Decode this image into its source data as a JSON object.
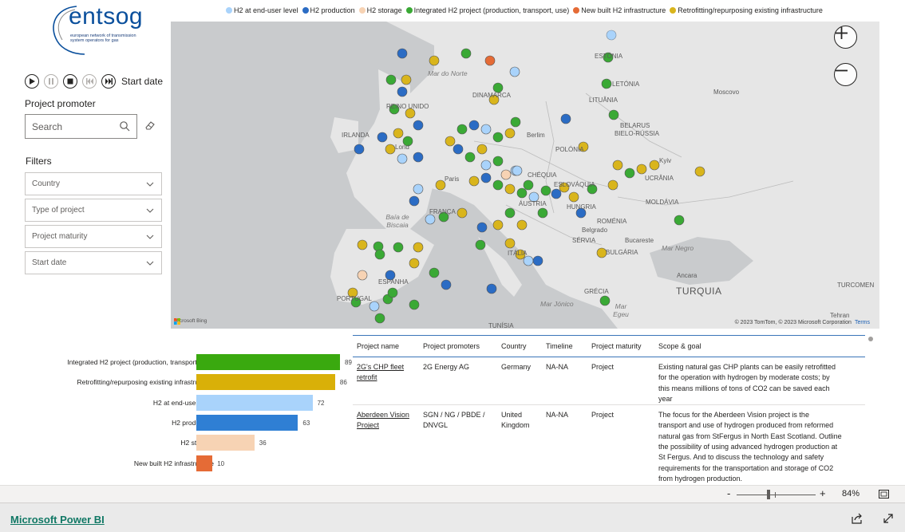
{
  "logo": {
    "wordmark": "entsog",
    "subtitle": "european network of transmission system operators for gas"
  },
  "playback": {
    "label": "Start date",
    "buttons": [
      "play-icon",
      "pause-icon",
      "stop-icon",
      "previous-icon",
      "next-icon"
    ]
  },
  "promoter": {
    "title": "Project promoter",
    "search_placeholder": "Search"
  },
  "filters": {
    "title": "Filters",
    "items": [
      {
        "label": "Country"
      },
      {
        "label": "Type of project"
      },
      {
        "label": "Project maturity"
      },
      {
        "label": "Start date"
      }
    ]
  },
  "legend": [
    {
      "label": "H2 at end-user level",
      "color": "#a9d3fb"
    },
    {
      "label": "H2 production",
      "color": "#2b6cc4"
    },
    {
      "label": "H2 storage",
      "color": "#f7d3b4"
    },
    {
      "label": "Integrated H2 project (production, transport, use)",
      "color": "#3aa935"
    },
    {
      "label": "New built H2 infrastructure",
      "color": "#e56b36"
    },
    {
      "label": "Retrofitting/repurposing existing infrastructure",
      "color": "#d9b51c"
    }
  ],
  "map": {
    "labels": {
      "mar_do_norte": "Mar do Norte",
      "reino_unido": "REINO UNIDO",
      "irlanda": "IRLANDA",
      "london": "Lond",
      "paris": "Paris",
      "franca": "FRANÇA",
      "baia": "Baía de Biscaia",
      "espanha": "ESPANHA",
      "portugal": "PORTUGAL",
      "italia": "ITÁLIA",
      "berlim": "Berlim",
      "polonia": "POLÓNIA",
      "chequia": "CHÉQUIA",
      "austria": "ÁUSTRIA",
      "eslovaquia": "ESLOVÁQUIA",
      "hungria": "HUNGRIA",
      "romenia": "ROMÉNIA",
      "moldavia": "MOLDÁVIA",
      "ucrania": "UCRÂNIA",
      "kyiv": "Kyiv",
      "belarus": "BELARUS",
      "bielo": "BIELO-RÚSSIA",
      "lituania": "LITUÂNIA",
      "letonia": "LETÓNIA",
      "estonia": "ESTÓNIA",
      "moscovo": "Moscovo",
      "dinamarca": "DINAMARCA",
      "belgrado": "Belgrado",
      "servia": "SÉRVIA",
      "bucareste": "Bucareste",
      "bulgaria": "BULGÁRIA",
      "mar_negro": "Mar Negro",
      "ancara": "Ancara",
      "turquia": "TURQUIA",
      "grecia": "GRÉCIA",
      "mar_jonico": "Mar Jónico",
      "mar_egeu": "Mar Egeu",
      "turcomen": "TURCOMEN",
      "tunisia": "TUNÍSIA",
      "tehran": "Tehran"
    },
    "bing": "Microsoft Bing",
    "copyright": "© 2023 TomTom, © 2023 Microsoft Corporation",
    "terms": "Terms"
  },
  "chart_data": {
    "type": "bar",
    "orientation": "horizontal",
    "categories": [
      "Integrated H2 project (production, transport, use)",
      "Retrofitting/repurposing existing infrastructure",
      "H2 at end-user level",
      "H2 production",
      "H2 storage",
      "New built H2 infrastructure"
    ],
    "values": [
      89,
      86,
      72,
      63,
      36,
      10
    ],
    "colors": [
      "#3aa90f",
      "#d9b008",
      "#a9d3fb",
      "#2f7fd4",
      "#f7d3b4",
      "#e56b36"
    ],
    "xlim": [
      0,
      89
    ]
  },
  "table": {
    "headers": [
      "Project name",
      "Project promoters",
      "Country",
      "Timeline",
      "Project maturity",
      "Scope & goal"
    ],
    "rows": [
      {
        "name": [
          "2G's CHP fleet",
          "retrofit"
        ],
        "promoters": [
          "2G Energy AG"
        ],
        "country": [
          "Germany"
        ],
        "timeline": "NA-NA",
        "maturity": "Project",
        "scope": [
          "Existing natural gas CHP plants can be easily retrofitted",
          "for the operation with hydrogen by moderate costs; by",
          "this means millions of tons of CO2 can be saved each",
          "year"
        ]
      },
      {
        "name": [
          "Aberdeen Vision",
          "Project"
        ],
        "promoters": [
          "SGN / NG / PBDE /",
          "DNVGL"
        ],
        "country": [
          "United",
          "Kingdom"
        ],
        "timeline": "NA-NA",
        "maturity": "Project",
        "scope": [
          "The focus for the Aberdeen Vision project is the",
          "transport and use of hydrogen produced from reformed",
          "natural gas from StFergus in North East Scotland. Outline",
          "the possibility of using advanced hydrogen production at",
          "St Fergus. And to discuss the technology and safety",
          "requirements for the transportation and storage of CO2",
          "from hydrogen production."
        ]
      }
    ]
  },
  "zoom": {
    "minus": "-",
    "plus": "+",
    "percent": "84%"
  },
  "footer": {
    "link": "Microsoft Power BI"
  }
}
